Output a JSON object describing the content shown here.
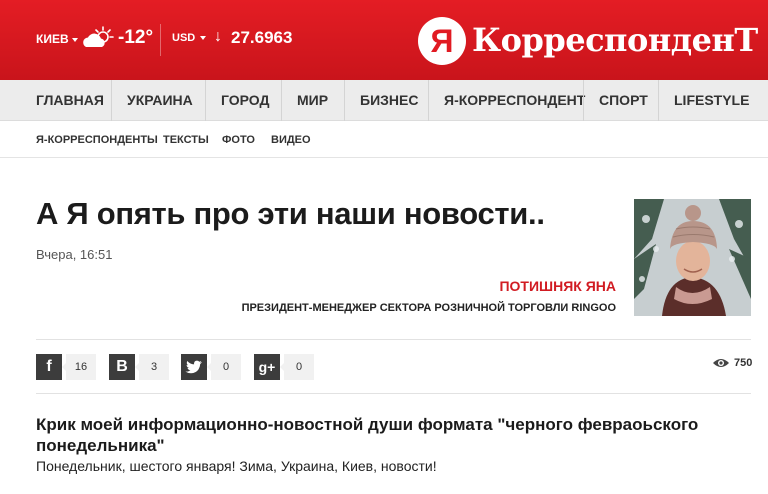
{
  "header": {
    "city": "КИЕВ",
    "temperature": "-12°",
    "currency": "USD",
    "rate": "27.6963",
    "rate_direction_icon": "arrow-down-icon",
    "weather_icon": "cloud-sun-icon",
    "logo_letter": "Я",
    "logo_text": "КорреспонденТ"
  },
  "nav": {
    "items": [
      "ГЛАВНАЯ",
      "УКРАИНА",
      "ГОРОД",
      "МИР",
      "БИЗНЕС",
      "Я-КОРРЕСПОНДЕНТ",
      "СПОРТ",
      "LIFESTYLE"
    ]
  },
  "subnav": {
    "items": [
      "Я-КОРРЕСПОНДЕНТЫ",
      "ТЕКСТЫ",
      "ФОТО",
      "ВИДЕО"
    ]
  },
  "article": {
    "title": "А Я опять про эти наши новости..",
    "date": "Вчера, 16:51",
    "author_name": "ПОТИШНЯК ЯНА",
    "author_position": "ПРЕЗИДЕНТ-МЕНЕДЖЕР СЕКТОРА РОЗНИЧНОЙ ТОРГОВЛИ RINGOO",
    "lead_title": "Крик моей информационно-новостной души формата \"черного февраоьского понедельника\"",
    "lead_text": "Понедельник, шестого января! Зима, Украина, Киев, новости!"
  },
  "share": {
    "facebook": {
      "icon": "f",
      "count": "16"
    },
    "vkontakte": {
      "icon": "B",
      "count": "3"
    },
    "twitter": {
      "icon": "twitter-bird-icon",
      "count": "0"
    },
    "googleplus": {
      "icon": "g+",
      "count": "0"
    },
    "views": "750"
  },
  "colors": {
    "brand_red": "#d91a21",
    "nav_bg": "#ececec"
  }
}
